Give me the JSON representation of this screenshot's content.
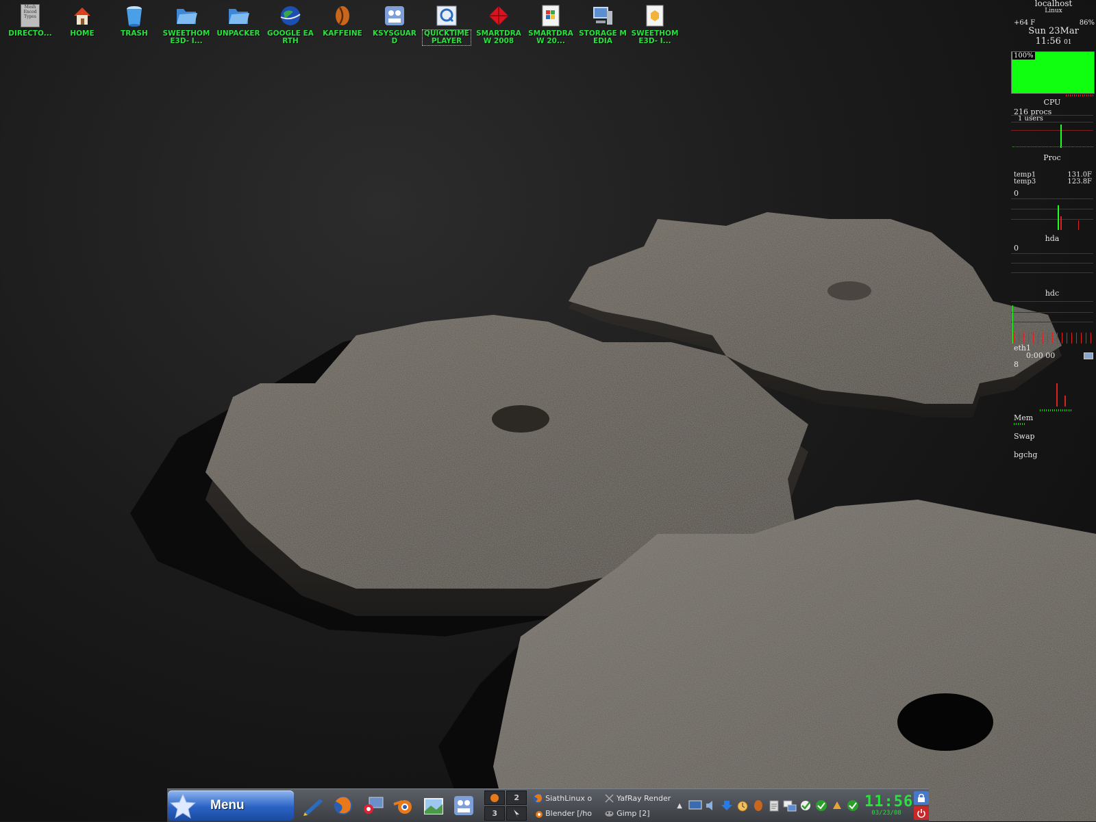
{
  "desktop_icons": [
    {
      "label": "DIRECTO...",
      "icon": "directory-icon"
    },
    {
      "label": "HOME",
      "icon": "home-icon"
    },
    {
      "label": "TRASH",
      "icon": "trash-icon"
    },
    {
      "label": "SWEETHOME3D- I...",
      "icon": "folder-icon"
    },
    {
      "label": "UNPACKER",
      "icon": "folder-icon"
    },
    {
      "label": "GOOGLE EARTH",
      "icon": "globe-icon"
    },
    {
      "label": "KAFFEINE",
      "icon": "kaffeine-icon"
    },
    {
      "label": "KSYSGUARD",
      "icon": "ksysguard-icon"
    },
    {
      "label": "QUICKTIME PLAYER",
      "icon": "quicktime-icon"
    },
    {
      "label": "SMARTDRAW 2008",
      "icon": "smartdraw-icon"
    },
    {
      "label": "SMARTDRAW 20...",
      "icon": "document-icon"
    },
    {
      "label": "STORAGE MEDIA",
      "icon": "storage-icon"
    },
    {
      "label": "SWEETHOME3D- I...",
      "icon": "package-icon"
    }
  ],
  "directory_icon_text": "Mesh Encod Types",
  "monitor": {
    "host": "localhost",
    "os": "Linux",
    "temp": "+64 F",
    "battery": "86%",
    "date": "Sun 23Mar",
    "time": "11:56",
    "seconds": "01",
    "cpu_percent": "100%",
    "cpu_label": "CPU",
    "procs": "216 procs",
    "users": "1 users",
    "proc_label": "Proc",
    "temp1_label": "temp1",
    "temp1_value": "131.0F",
    "temp3_label": "temp3",
    "temp3_value": "123.8F",
    "zero1": "0",
    "hda_label": "hda",
    "zero2": "0",
    "hdc_label": "hdc",
    "eth_label": "eth1",
    "eth_time": "0:00",
    "eth_time2": "00",
    "eth_value": "8",
    "mem_label": "Mem",
    "swap_label": "Swap",
    "extra_label": "bgchg"
  },
  "taskbar": {
    "menu_label": "Menu",
    "quick_launch": [
      "edit-icon",
      "firefox-icon",
      "remote-desktop-icon",
      "blender-icon",
      "image-viewer-icon",
      "ksysguard-icon"
    ],
    "pager": [
      "",
      "2",
      "3",
      ""
    ],
    "tasks": [
      {
        "label": "SiathLinux o",
        "icon": "firefox-icon"
      },
      {
        "label": "YafRay Render",
        "icon": "yafray-icon"
      },
      {
        "label": "Blender [/ho",
        "icon": "blender-icon"
      },
      {
        "label": "Gimp [2]",
        "icon": "gimp-icon"
      }
    ],
    "tray": [
      "display-icon",
      "speaker-icon",
      "download-icon",
      "alarm-clock-icon",
      "kaffeine-icon",
      "clipboard-icon",
      "network-icon",
      "update-check-icon",
      "check-icon",
      "messenger-icon",
      "check-icon"
    ],
    "clock_time": "11:56",
    "clock_date": "03/23/08",
    "colors": {
      "clock": "#27e33b",
      "menu": "#2a63c4"
    }
  }
}
